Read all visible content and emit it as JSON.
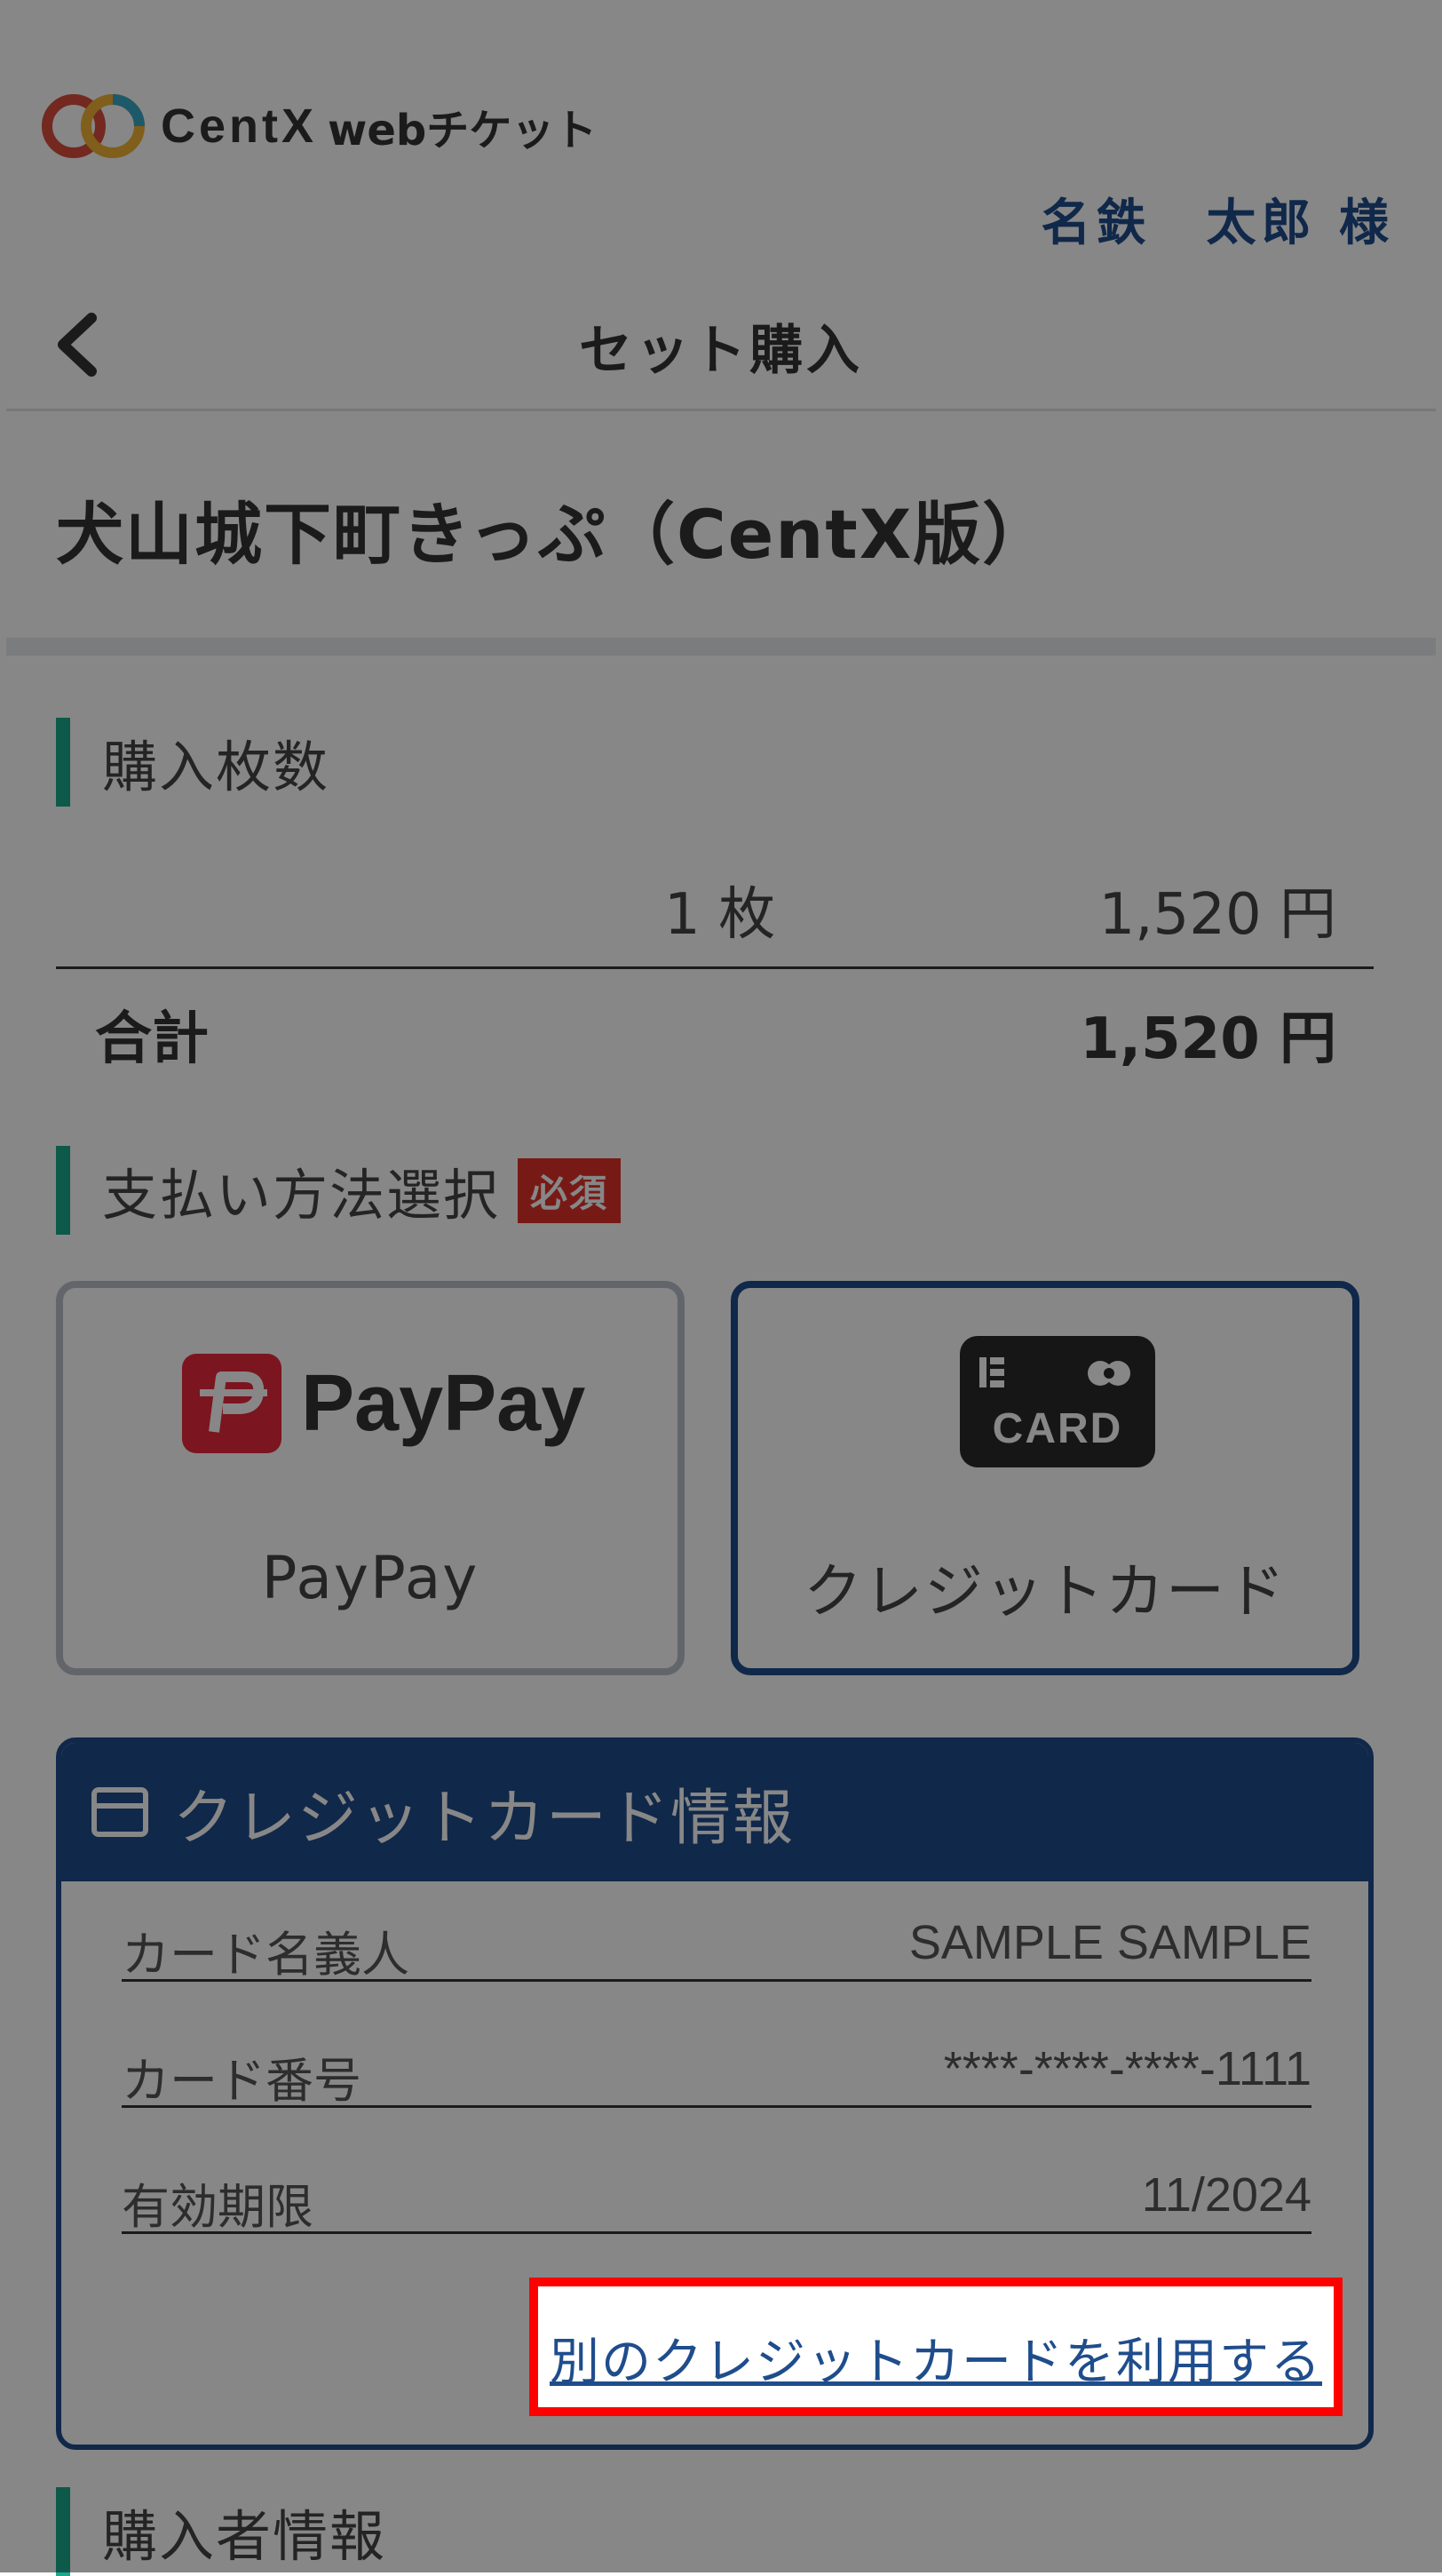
{
  "header": {
    "logo_text": "CentX",
    "logo_sub": "webチケット",
    "user_name": "名鉄　太郎 様"
  },
  "nav": {
    "title": "セット購入"
  },
  "product": {
    "title": "犬山城下町きっぷ（CentX版）"
  },
  "purchase": {
    "section_label": "購入枚数",
    "quantity": "1 枚",
    "unit_price": "1,520 円",
    "total_label": "合計",
    "total_price": "1,520 円"
  },
  "payment": {
    "section_label": "支払い方法選択",
    "required_badge": "必須",
    "options": [
      {
        "label": "PayPay",
        "logo_text": "PayPay",
        "selected": false
      },
      {
        "label": "クレジットカード",
        "logo_text": "CARD",
        "selected": true
      }
    ]
  },
  "credit_card": {
    "header": "クレジットカード情報",
    "fields": [
      {
        "label": "カード名義人",
        "value": "SAMPLE SAMPLE"
      },
      {
        "label": "カード番号",
        "value": "****-****-****-1111"
      },
      {
        "label": "有効期限",
        "value": "11/2024"
      }
    ],
    "other_card_link": "別のクレジットカードを利用する"
  },
  "buyer": {
    "section_label": "購入者情報"
  },
  "colors": {
    "accent_green": "#1aa98d",
    "brand_blue": "#1f4d8c",
    "required_red": "#e0312b",
    "highlight_red": "#ff0000"
  }
}
